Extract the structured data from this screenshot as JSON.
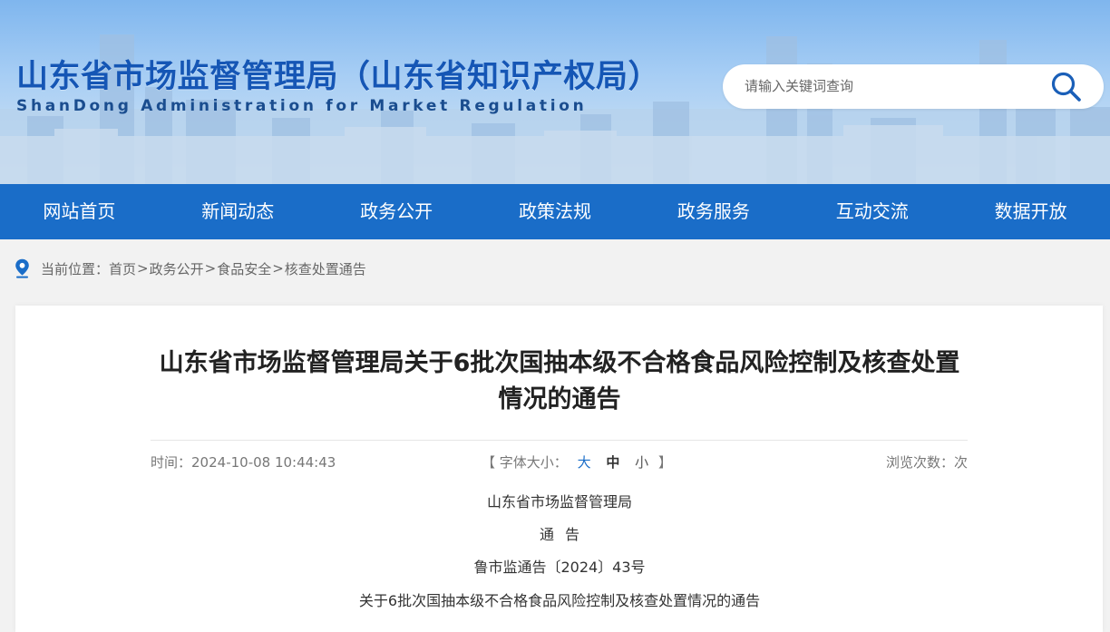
{
  "header": {
    "title": "山东省市场监督管理局（山东省知识产权局）",
    "subtitle": "ShanDong Administration for Market Regulation"
  },
  "search": {
    "placeholder": "请输入关键词查询",
    "icon": "search-icon"
  },
  "nav": {
    "items": [
      {
        "label": "网站首页"
      },
      {
        "label": "新闻动态"
      },
      {
        "label": "政务公开"
      },
      {
        "label": "政策法规"
      },
      {
        "label": "政务服务"
      },
      {
        "label": "互动交流"
      },
      {
        "label": "数据开放"
      }
    ]
  },
  "breadcrumb": {
    "icon": "location-pin-icon",
    "prefix": "当前位置：",
    "separator": ">",
    "items": [
      "首页",
      "政务公开",
      "食品安全",
      "核查处置通告"
    ]
  },
  "article": {
    "title": "山东省市场监督管理局关于6批次国抽本级不合格食品风险控制及核查处置情况的通告",
    "time_label": "时间：",
    "time": "2024-10-08 10:44:43",
    "font_size_open": "【 字体大小：",
    "font_size_options": [
      "大",
      "中",
      "小"
    ],
    "font_size_close": "】",
    "views_label": "浏览次数：次",
    "body_lines": [
      "山东省市场监督管理局",
      "通告",
      "鲁市监通告〔2024〕43号",
      "关于6批次国抽本级不合格食品风险控制及核查处置情况的通告"
    ]
  },
  "colors": {
    "brand_blue": "#1a6dc8",
    "title_blue": "#1556b5",
    "page_bg": "#f2f2f2"
  }
}
